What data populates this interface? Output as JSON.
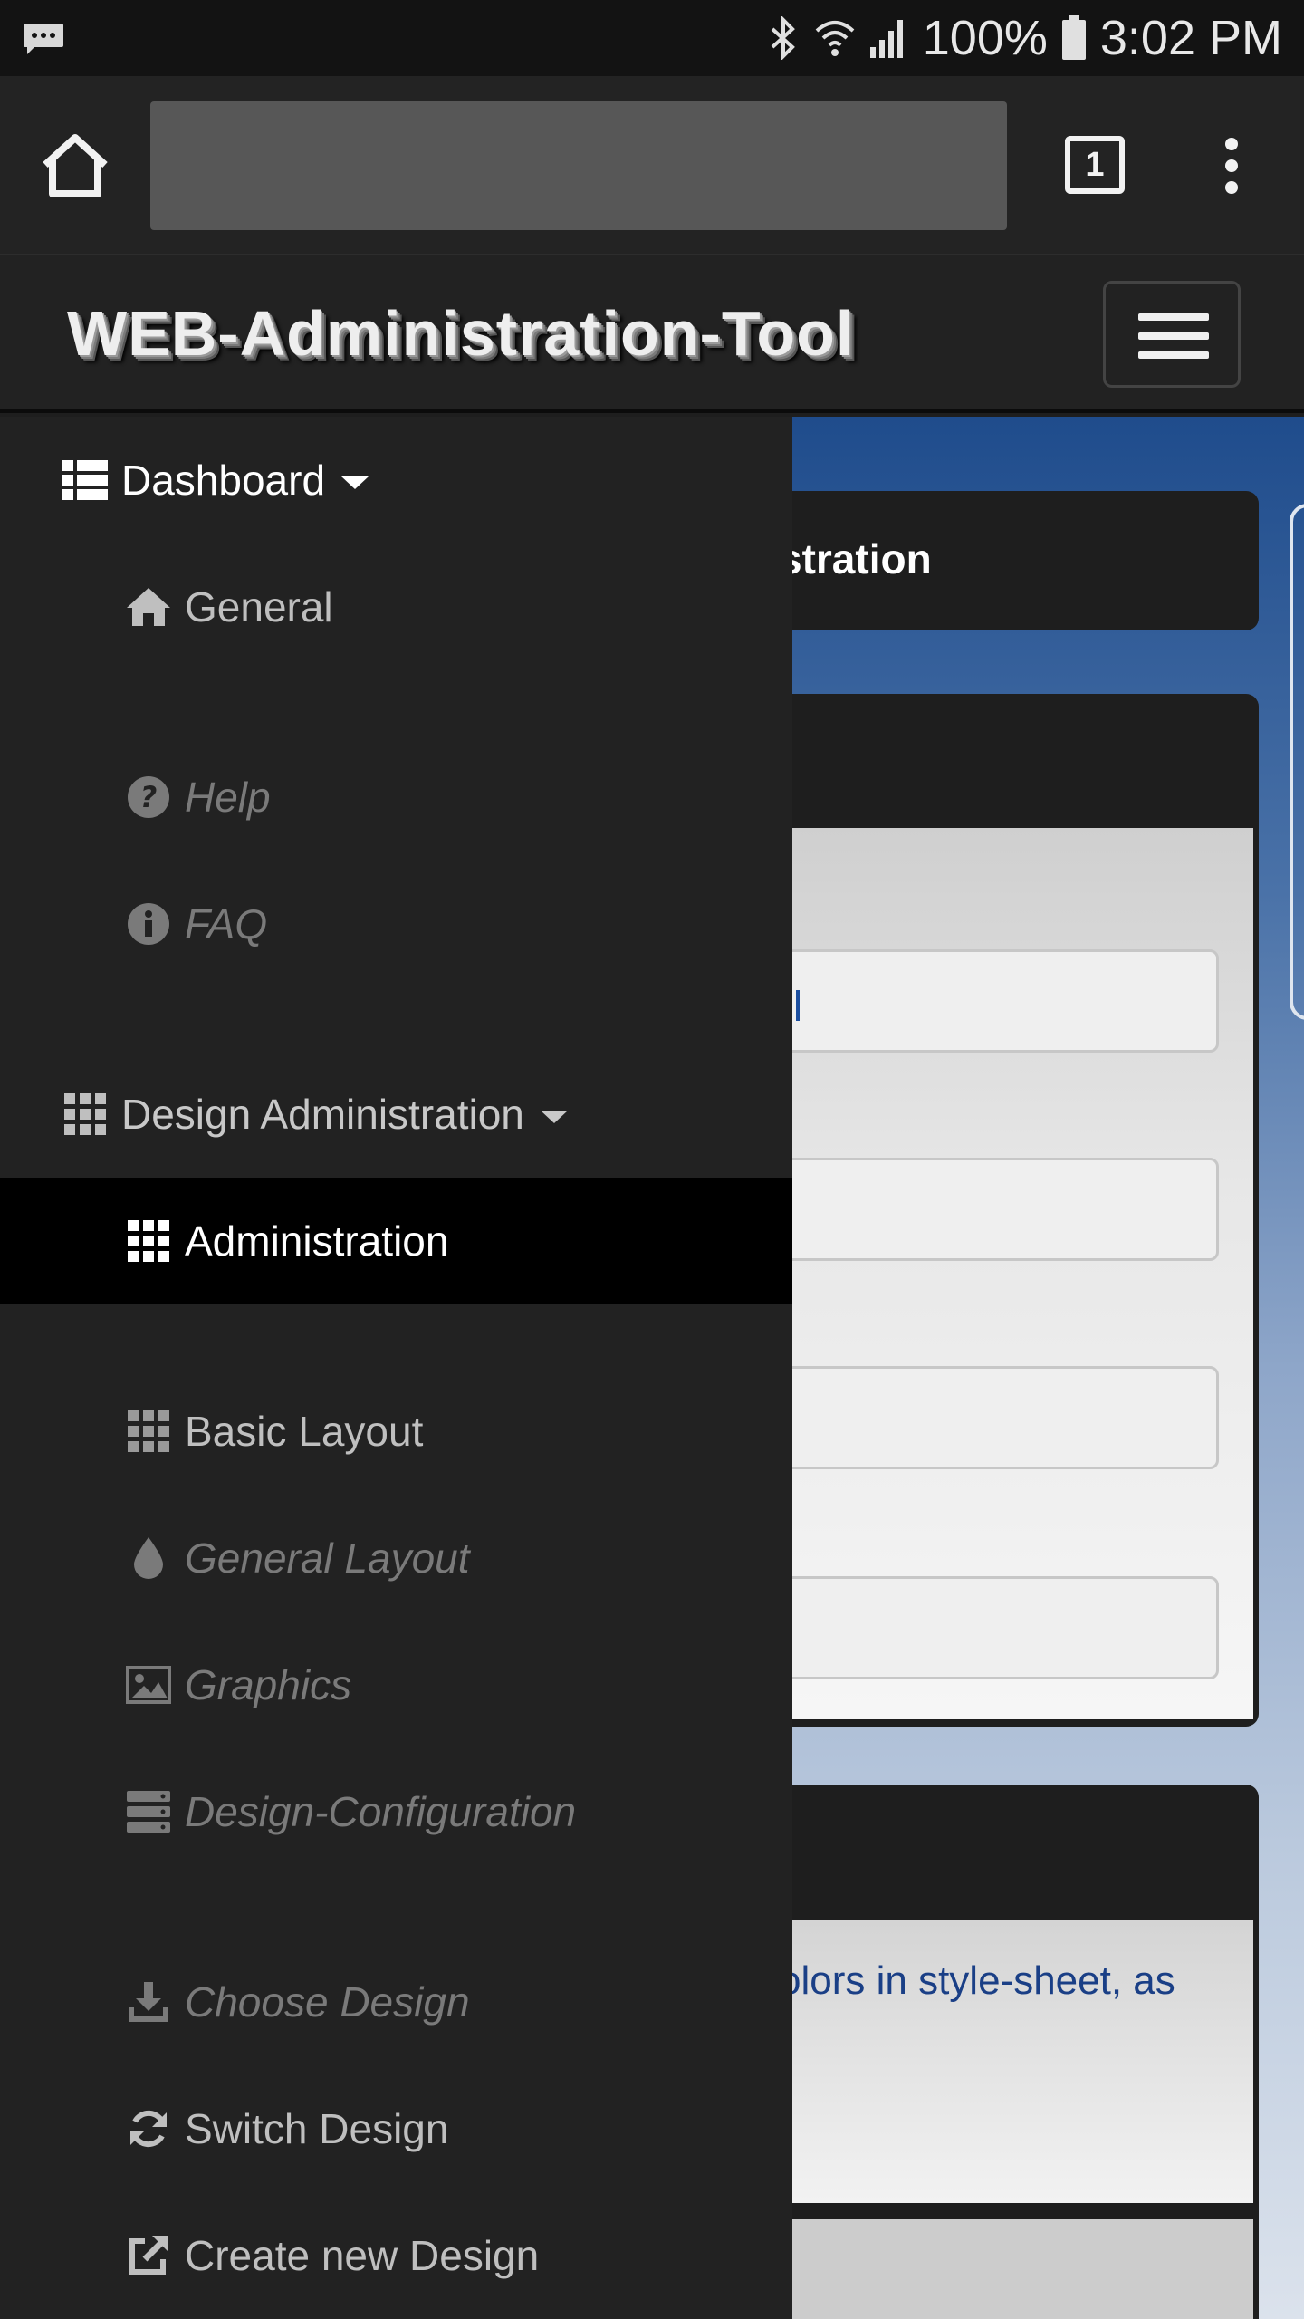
{
  "status_bar": {
    "battery": "100%",
    "time": "3:02 PM"
  },
  "browser": {
    "tab_count": "1"
  },
  "app": {
    "title": "WEB-Administration-Tool"
  },
  "background": {
    "panel_title_fragment": "stration",
    "panel_info_fragment": "olors in style-sheet, as"
  },
  "nav": {
    "dashboard": "Dashboard",
    "general": "General",
    "help": "Help",
    "faq": "FAQ",
    "design_admin": "Design Administration",
    "administration": "Administration",
    "basic_layout": "Basic Layout",
    "general_layout": "General Layout",
    "graphics": "Graphics",
    "design_configuration": "Design-Configuration",
    "choose_design": "Choose Design",
    "switch_design": "Switch Design",
    "create_new_design": "Create new Design"
  },
  "colors": {
    "drawer_bg": "#222222",
    "active_bg": "#000000",
    "link_blue": "#1a3f86",
    "header_bg": "#222222"
  }
}
